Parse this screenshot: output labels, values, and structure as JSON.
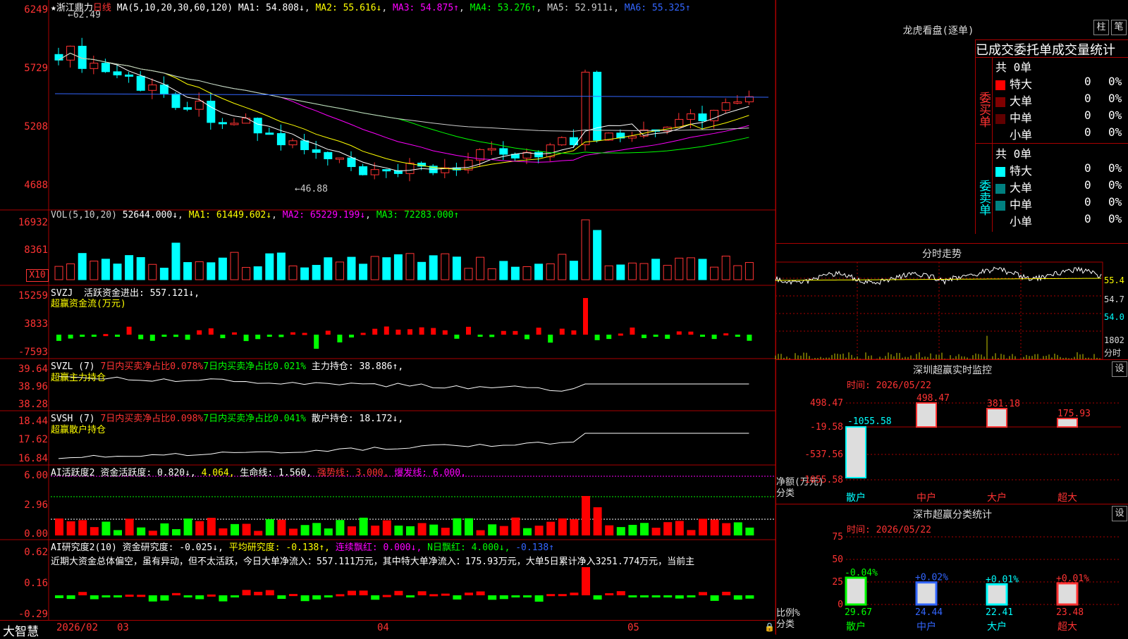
{
  "stock": {
    "star": "★",
    "name": "浙江鼎力",
    "period": "日线"
  },
  "ma_line": {
    "label": "MA(5,10,20,30,60,120)",
    "ma1": "MA1: 54.808↓",
    "ma2": "MA2: 55.616↓",
    "ma3": "MA3: 54.875↑",
    "ma4": "MA4: 53.276↑",
    "ma5": "MA5: 52.911↓",
    "ma6": "MA6: 55.325↑"
  },
  "price_axis": [
    "6249",
    "5729",
    "5208",
    "4688"
  ],
  "price_annotations": {
    "high": "62.49",
    "low": "46.88"
  },
  "vol": {
    "label": "VOL(5,10,20)",
    "value": "52644.000↓",
    "ma1": "MA1: 61449.602↓",
    "ma2": "MA2: 65229.199↓",
    "ma3": "MA3: 72283.000↑",
    "axis": [
      "16932",
      "8361"
    ],
    "unit": "X10"
  },
  "svzj": {
    "label": "SVZJ",
    "title": "活跃资金进出: 557.121↓,",
    "sub": "超赢资金流(万元)",
    "axis": [
      "15259",
      "3833",
      "-7593"
    ]
  },
  "svzl": {
    "label": "SVZL (7)",
    "a": "7日内买卖净占比0.078%",
    "b": "7日内买卖净占比0.021%",
    "c": "主力持仓: 38.886↑,",
    "sub": "超赢主力持仓",
    "axis": [
      "39.64",
      "38.96",
      "38.28"
    ]
  },
  "svsh": {
    "label": "SVSH (7)",
    "a": "7日内买卖净占比0.098%",
    "b": "7日内买卖净占比0.041%",
    "c": "散户持仓: 18.172↓,",
    "sub": "超赢散户持仓",
    "axis": [
      "18.44",
      "17.62",
      "16.84"
    ]
  },
  "ai1": {
    "label": "AI活跃度2",
    "a": "资金活跃度: 0.820↓,",
    "b": "4.064,",
    "c": "生命线: 1.560,",
    "d": "强势线: 3.000,",
    "e": "爆发线: 6.000,",
    "axis": [
      "6.00",
      "2.96",
      "0.00"
    ]
  },
  "ai2": {
    "label": "AI研究度2(10)",
    "a": "资金研究度: -0.025↓,",
    "b": "平均研究度: -0.138↑,",
    "c": "连续飘红: 0.000↓,",
    "d": "N日飘红: 4.000↓,",
    "e": "-0.138↑",
    "text": "近期大资金总体偏空，虽有异动，但不太活跃，今日大单净流入：557.111万元，其中特大单净流入：175.93万元，大单5日累计净入3251.774万元，当前主",
    "axis": [
      "0.62",
      "0.16",
      "-0.29"
    ]
  },
  "bottom": {
    "brand": "大智慧",
    "d1": "2026/02",
    "d2": "03",
    "d3": "04",
    "d4": "05"
  },
  "lhb": {
    "title": "龙虎看盘(逐单)",
    "btn1": "柱",
    "btn2": "笔",
    "header": "已成交委托单成交量统计",
    "buy_label": "委买单",
    "sell_label": "委卖单",
    "buy_total": "共 0单",
    "sell_total": "共 0单",
    "buy_rows": [
      {
        "name": "特大",
        "n": "0",
        "p": "0%"
      },
      {
        "name": "大单",
        "n": "0",
        "p": "0%"
      },
      {
        "name": "中单",
        "n": "0",
        "p": "0%"
      },
      {
        "name": "小单",
        "n": "0",
        "p": "0%"
      }
    ],
    "sell_rows": [
      {
        "name": "特大",
        "n": "0",
        "p": "0%"
      },
      {
        "name": "大单",
        "n": "0",
        "p": "0%"
      },
      {
        "name": "中单",
        "n": "0",
        "p": "0%"
      },
      {
        "name": "小单",
        "n": "0",
        "p": "0%"
      }
    ]
  },
  "intraday": {
    "title": "分时走势",
    "axis": [
      "55.4",
      "54.7",
      "54.0"
    ],
    "vol": "1802",
    "vol_unit": "分时"
  },
  "monitor": {
    "title": "深圳超赢实时监控",
    "btn": "设",
    "time": "时间: 2026/05/22",
    "axis": [
      "498.47",
      "-19.58",
      "-537.56",
      "-1055.58"
    ],
    "ylabel": "净额(万元)",
    "xlabel": "分类",
    "cats": [
      "散户",
      "中户",
      "大户",
      "超大"
    ],
    "values": [
      -1055.58,
      498.47,
      381.18,
      175.93
    ],
    "labels": [
      "-1055.58",
      "498.47",
      "381.18",
      "175.93"
    ]
  },
  "classify": {
    "title": "深市超赢分类统计",
    "btn": "设",
    "time": "时间: 2026/05/22",
    "axis": [
      "75",
      "50",
      "25",
      "0"
    ],
    "ylabel": "比例%",
    "xlabel": "分类",
    "cats": [
      "散户",
      "中户",
      "大户",
      "超大"
    ],
    "values": [
      29.67,
      24.44,
      22.41,
      23.48
    ],
    "changes": [
      "-0.04%",
      "+0.02%",
      "+0.01%",
      "+0.01%"
    ],
    "labels": [
      "29.67",
      "24.44",
      "22.41",
      "23.48"
    ]
  },
  "colors": {
    "up": "#ff3232",
    "down": "#00ffff",
    "grid": "#a00000",
    "yellow": "#ffff00",
    "magenta": "#ff00ff",
    "green": "#00ff00",
    "white": "#ffffff",
    "blue": "#3050ff"
  }
}
